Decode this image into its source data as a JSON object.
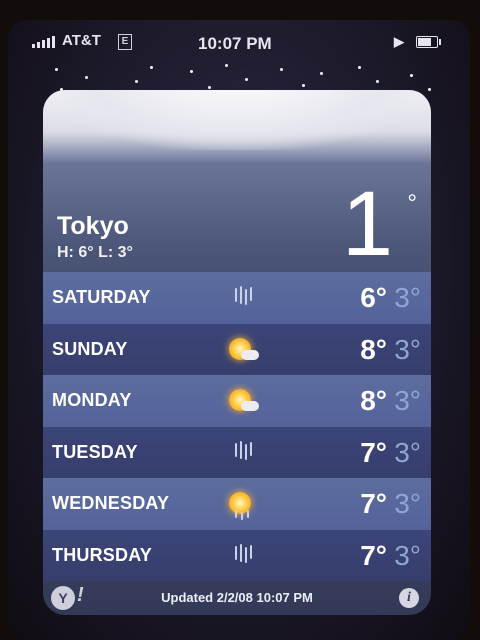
{
  "status_bar": {
    "carrier": "AT&T",
    "network_badge": "E",
    "time": "10:07 PM",
    "icons": [
      "signal-bars-icon",
      "play-icon",
      "battery-icon"
    ]
  },
  "current": {
    "city": "Tokyo",
    "hilo": "H: 6° L: 3°",
    "temperature": "1",
    "degree_symbol": "°"
  },
  "forecast": [
    {
      "day": "SATURDAY",
      "condition": "rain",
      "high": "6°",
      "low": "3°"
    },
    {
      "day": "SUNDAY",
      "condition": "partly-sunny",
      "high": "8°",
      "low": "3°"
    },
    {
      "day": "MONDAY",
      "condition": "partly-sunny",
      "high": "8°",
      "low": "3°"
    },
    {
      "day": "TUESDAY",
      "condition": "rain",
      "high": "7°",
      "low": "3°"
    },
    {
      "day": "WEDNESDAY",
      "condition": "sun-rain",
      "high": "7°",
      "low": "3°"
    },
    {
      "day": "THURSDAY",
      "condition": "rain",
      "high": "7°",
      "low": "3°"
    }
  ],
  "footer": {
    "yahoo_logo": "Y",
    "yahoo_bang": "!",
    "updated": "Updated 2/2/08 10:07 PM",
    "info_label": "i"
  },
  "colors": {
    "low_temp": "#8ea6d4",
    "row_light": "#5d6d9e",
    "row_dark": "#3c4578"
  }
}
